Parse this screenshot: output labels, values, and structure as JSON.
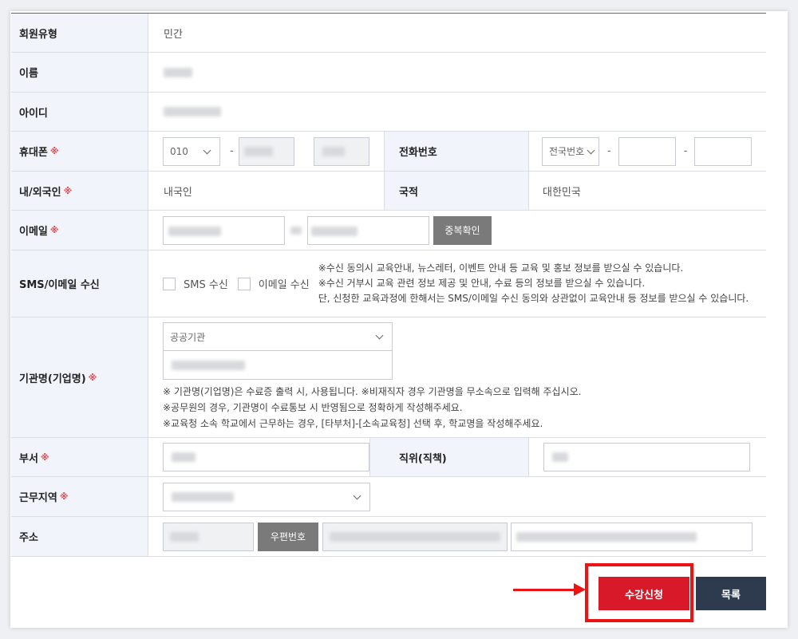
{
  "required_mark": "※",
  "rows": {
    "member_type": {
      "label": "회원유형",
      "value": "민간"
    },
    "name": {
      "label": "이름"
    },
    "user_id": {
      "label": "아이디"
    },
    "mobile": {
      "label": "휴대폰",
      "prefix": "010",
      "dash": "-"
    },
    "phone": {
      "label": "전화번호",
      "area_code": "전국번호",
      "dash": "-"
    },
    "nationality_type": {
      "label": "내/외국인",
      "value": "내국인"
    },
    "country": {
      "label": "국적",
      "value": "대한민국"
    },
    "email": {
      "label": "이메일",
      "check_button": "중복확인"
    },
    "sms_email": {
      "label": "SMS/이메일 수신",
      "sms_option": "SMS 수신",
      "email_option": "이메일 수신",
      "notes": [
        "※수신 동의시 교육안내, 뉴스레터, 이벤트 안내 등 교육 및 홍보 정보를 받으실 수 있습니다.",
        "※수신 거부시 교육 관련 정보 제공 및 안내, 수료 등의 정보를 받으실 수 있습니다.",
        "단, 신청한 교육과정에 한해서는 SMS/이메일 수신 동의와 상관없이 교육안내 등 정보를 받으실 수 있습니다."
      ]
    },
    "organization": {
      "label": "기관명(기업명)",
      "type_value": "공공기관",
      "notes": [
        "※ 기관명(기업명)은 수료증 출력 시, 사용됩니다. ※비재직자 경우 기관명을 무소속으로 입력해 주십시오.",
        "※공무원의 경우, 기관명이 수료통보 시 반영됨으로 정확하게 작성해주세요.",
        "※교육청 소속 학교에서 근무하는 경우, [타부처]-[소속교육청] 선택 후, 학교명을 작성해주세요."
      ]
    },
    "department": {
      "label": "부서"
    },
    "position": {
      "label": "직위(직책)"
    },
    "work_region": {
      "label": "근무지역"
    },
    "address": {
      "label": "주소",
      "zip_button": "우편번호"
    }
  },
  "actions": {
    "apply": "수강신청",
    "list": "목록"
  },
  "colors": {
    "apply_button": "#d8192a",
    "list_button": "#2e3a4e",
    "highlight": "#ee1313",
    "required": "#e8424b"
  }
}
